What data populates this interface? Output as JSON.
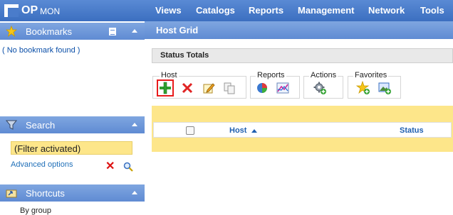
{
  "app": {
    "logo_op": "OP",
    "logo_mon": "MON"
  },
  "menu": {
    "items": [
      "Views",
      "Catalogs",
      "Reports",
      "Management",
      "Network",
      "Tools"
    ]
  },
  "sidebar": {
    "bookmarks": {
      "title": "Bookmarks",
      "empty_text": "( No bookmark found )"
    },
    "search": {
      "title": "Search",
      "filter_value": "(Filter activated)",
      "advanced_link": "Advanced options"
    },
    "shortcuts": {
      "title": "Shortcuts",
      "first_item": "By group"
    }
  },
  "main": {
    "title": "Host Grid",
    "status_totals": "Status Totals",
    "toolbar": {
      "groups": [
        {
          "label": "Host",
          "tools": [
            "add-host-icon",
            "delete-icon",
            "edit-icon",
            "copy-icon"
          ]
        },
        {
          "label": "Reports",
          "tools": [
            "pie-report-icon",
            "chart-report-icon"
          ]
        },
        {
          "label": "Actions",
          "tools": [
            "gear-action-icon"
          ]
        },
        {
          "label": "Favorites",
          "tools": [
            "star-add-icon",
            "image-add-icon"
          ]
        }
      ]
    },
    "grid": {
      "columns": {
        "host": "Host",
        "status": "Status"
      },
      "sort": "host-ascending"
    }
  },
  "colors": {
    "accent": "#4a7ccb",
    "header": "#5f8bd3",
    "highlight": "#fde68a",
    "selected": "#e81c1c"
  }
}
